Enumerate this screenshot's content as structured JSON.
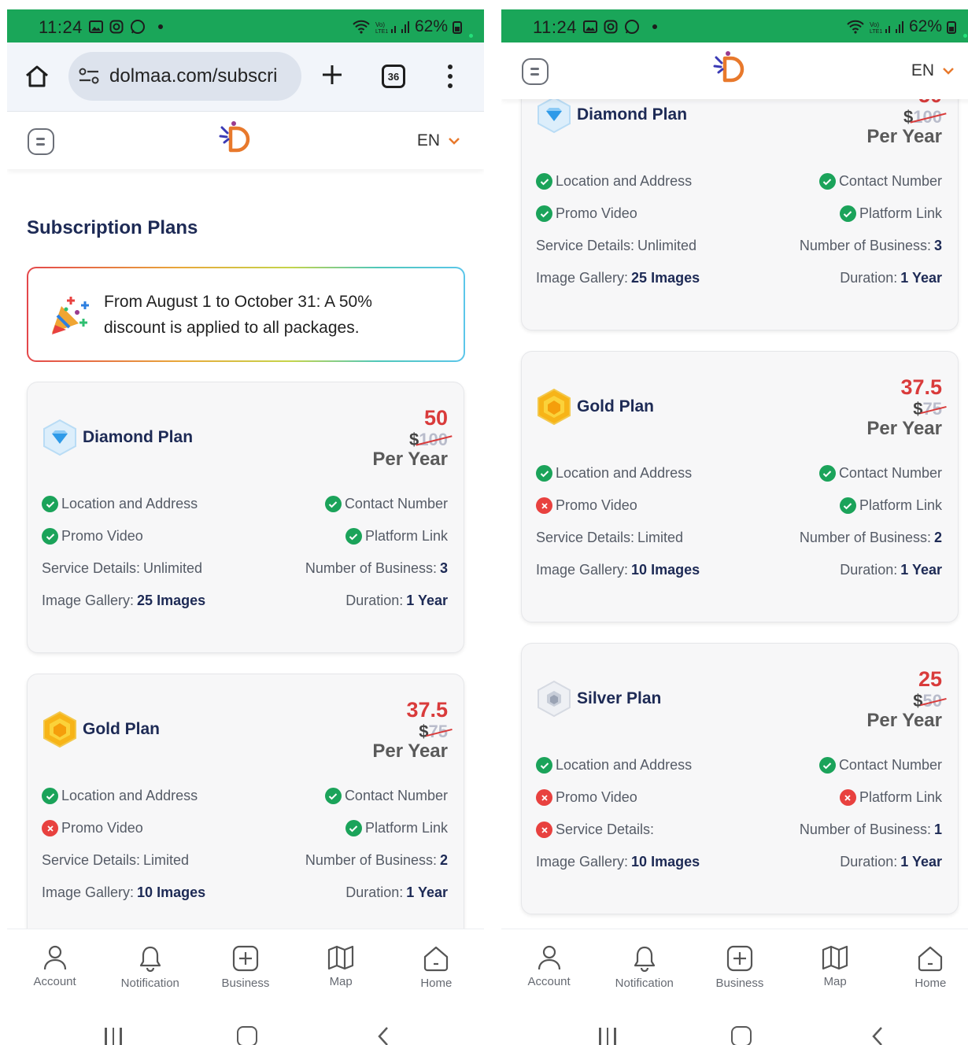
{
  "status_bar": {
    "time": "11:24",
    "battery": "62%",
    "network": "Vo)) LTE1"
  },
  "browser": {
    "url": "dolmaa.com/subscri",
    "tab_count": "36"
  },
  "app_header": {
    "lang": "EN"
  },
  "page": {
    "title": "Subscription Plans",
    "promo_text": "From August 1 to October 31: A 50% discount is applied to all packages."
  },
  "labels": {
    "per_year": "Per Year",
    "dollar": "$",
    "location": "Location and Address",
    "contact": "Contact Number",
    "promo": "Promo Video",
    "platform": "Platform Link"
  },
  "plans": {
    "diamond": {
      "name": "Diamond Plan",
      "new_price": "50",
      "old_price": "100",
      "service_label": "Service Details:",
      "service_value": " Unlimited",
      "business_label": "Number of Business: ",
      "business_value": "3",
      "gallery_label": "Image Gallery: ",
      "gallery_value": "25 Images",
      "duration_label": "Duration: ",
      "duration_value": "1 Year",
      "location_ok": true,
      "contact_ok": true,
      "promo_ok": true,
      "platform_ok": true,
      "service_ok": true
    },
    "gold": {
      "name": "Gold Plan",
      "new_price": "37.5",
      "old_price": "75",
      "service_label": "Service Details:",
      "service_value": "Limited",
      "business_label": "Number of Business: ",
      "business_value": "2",
      "gallery_label": "Image Gallery:",
      "gallery_value": "10 Images",
      "duration_label": "Duration:",
      "duration_value": "1 Year",
      "location_ok": true,
      "contact_ok": true,
      "promo_ok": false,
      "platform_ok": true,
      "service_ok": true
    },
    "silver": {
      "name": "Silver Plan",
      "new_price": "25",
      "old_price": "50",
      "service_label": "Service Details:",
      "service_value": "",
      "business_label": "Number of Business: ",
      "business_value": "1",
      "gallery_label": "Image Gallery:",
      "gallery_value": "10 Images",
      "duration_label": "Duration:",
      "duration_value": "1 Year",
      "location_ok": true,
      "contact_ok": true,
      "promo_ok": false,
      "platform_ok": false,
      "service_ok": false
    }
  },
  "bottom_nav": {
    "account": "Account",
    "notification": "Notification",
    "business": "Business",
    "map": "Map",
    "home": "Home"
  },
  "colors": {
    "status_green": "#1aa659",
    "title_navy": "#1d2a55",
    "price_red": "#d93b3b",
    "check_green": "#1ba35a",
    "cross_red": "#e8413f",
    "logo_orange": "#e8792c"
  },
  "icons": [
    "home-icon",
    "site-info-icon",
    "plus-icon",
    "tabs-icon",
    "more-icon",
    "menu-icon",
    "logo-icon",
    "chevron-down-icon",
    "party-popper-icon",
    "diamond-icon",
    "gold-icon",
    "silver-icon",
    "check-icon",
    "cross-icon",
    "user-icon",
    "bell-icon",
    "plus-square-icon",
    "map-icon",
    "house-icon"
  ]
}
